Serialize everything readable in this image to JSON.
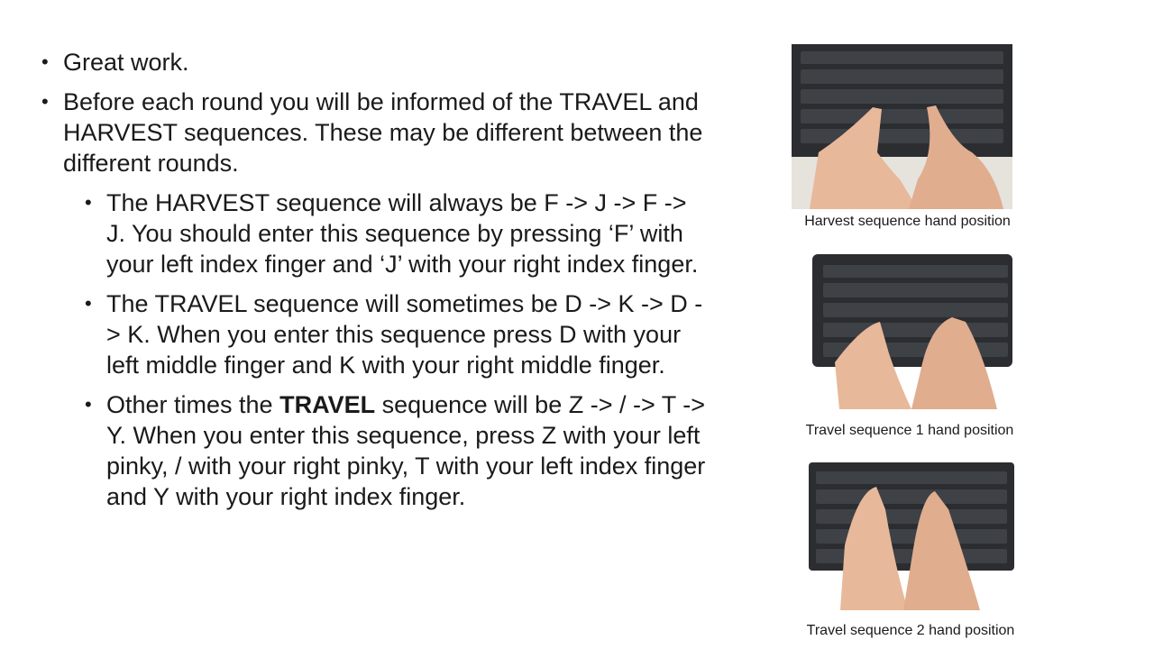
{
  "bullets": {
    "b1": "Great work.",
    "b2": "Before each round you will be informed of the TRAVEL and HARVEST sequences. These may be different between the different rounds.",
    "b3": "The HARVEST sequence will always be F -> J -> F -> J. You should enter this sequence by pressing ‘F’ with your left index finger and ‘J’ with your right index finger.",
    "b4": "The TRAVEL sequence will sometimes be D -> K -> D -> K. When you enter this sequence press D with your left middle finger and K with your right middle finger.",
    "b5_pre": "Other times the ",
    "b5_bold": "TRAVEL",
    "b5_post": " sequence will be Z -> / -> T -> Y. When you enter this sequence, press Z with your left pinky, / with your right pinky, T with your left index finger and Y with your right index finger."
  },
  "images": [
    {
      "caption": "Harvest sequence hand position",
      "icon": "keyboard-hands-photo"
    },
    {
      "caption": "Travel sequence 1 hand position",
      "icon": "keyboard-hands-photo"
    },
    {
      "caption": "Travel sequence 2 hand position",
      "icon": "keyboard-hands-photo"
    }
  ],
  "colors": {
    "text": "#1a1a1a",
    "keyboard": "#2b2d30",
    "skin": "#e8b89a"
  }
}
